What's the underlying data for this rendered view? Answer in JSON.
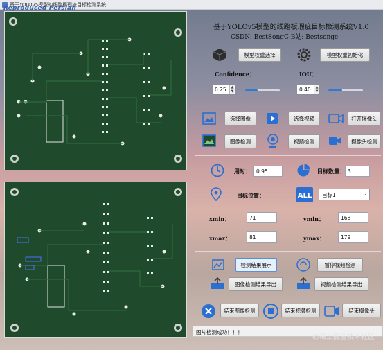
{
  "window": {
    "title": "基于YOLOv5模型的线路板瑕疵目标检测系统",
    "watermark": "Reproduced Persian"
  },
  "header": {
    "title": "基于YOLOv5模型的线路板瑕疵目标检测系统V1.0",
    "subtitle": "CSDN: BestSongC  B站: Bestsongc"
  },
  "model": {
    "select_label": "模型权重选择",
    "init_label": "模型权重初始化",
    "confidence_label": "Confidence：",
    "iou_label": "IOU：",
    "confidence_value": "0.25",
    "iou_value": "0.40",
    "confidence_level": 0.35,
    "iou_level": 0.4
  },
  "actions": {
    "select_image": "选择图像",
    "select_video": "选择视频",
    "open_camera": "打开摄像头",
    "image_detect": "图像检测",
    "video_detect": "视频检测",
    "camera_detect": "摄像头检测"
  },
  "results": {
    "time_label": "用时：",
    "time_value": "0.95",
    "count_label": "目标数量：",
    "count_value": "3",
    "position_label": "目标位置：",
    "target_select": "目标1",
    "xmin_label": "xmin：",
    "xmin_value": "71",
    "ymin_label": "ymin：",
    "ymin_value": "168",
    "xmax_label": "xmax：",
    "xmax_value": "81",
    "ymax_label": "ymax：",
    "ymax_value": "179"
  },
  "controls": {
    "show_result": "检测结果展示",
    "pause_video": "暂停视频检测",
    "export_image": "图像检测结果导出",
    "export_video": "视频检测结果导出",
    "end_image": "结束图像检测",
    "end_video": "结束视频检测",
    "end_camera": "结束摄像头"
  },
  "status": {
    "message": "图片检测成功！！！"
  },
  "footer_watermark": "@稀土掘金技术社区",
  "colors": {
    "pcb": "#1f4a2b",
    "accent": "#2f79d2",
    "icon_blue": "#2a6fd1"
  }
}
